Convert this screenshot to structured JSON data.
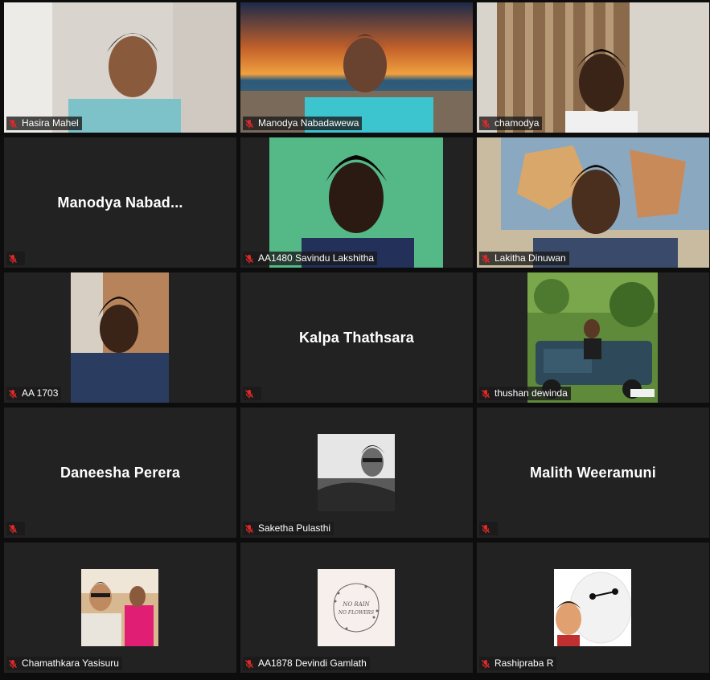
{
  "participants": [
    {
      "name": "Hasira Mahel",
      "muted": true
    },
    {
      "name": "Manodya Nabadawewa",
      "muted": true
    },
    {
      "name": "chamodya",
      "muted": true
    },
    {
      "name": "",
      "display_name": "Manodya  Nabad...",
      "muted": true
    },
    {
      "name": "AA1480 Savindu Lakshitha",
      "muted": true
    },
    {
      "name": "Lakitha Dinuwan",
      "muted": true
    },
    {
      "name": "AA 1703",
      "muted": true
    },
    {
      "name": "",
      "display_name": "Kalpa Thathsara",
      "muted": true
    },
    {
      "name": "thushan dewinda",
      "muted": true
    },
    {
      "name": "",
      "display_name": "Daneesha Perera",
      "muted": true
    },
    {
      "name": "Saketha Pulasthi",
      "muted": true
    },
    {
      "name": "",
      "display_name": "Malith Weeramuni",
      "muted": true
    },
    {
      "name": "Chamathkara Yasisuru",
      "muted": true
    },
    {
      "name": "AA1878 Devindi Gamlath",
      "muted": true
    },
    {
      "name": "Rashipraba R",
      "muted": true
    }
  ],
  "avatar_text": {
    "line1": "NO RAIN",
    "line2": "NO FLOWERS"
  },
  "icons": {
    "muted": "muted-microphone-icon"
  },
  "colors": {
    "tile_bg": "#222222",
    "mute_red": "#e02828",
    "label_bg": "#1a1a1a"
  }
}
